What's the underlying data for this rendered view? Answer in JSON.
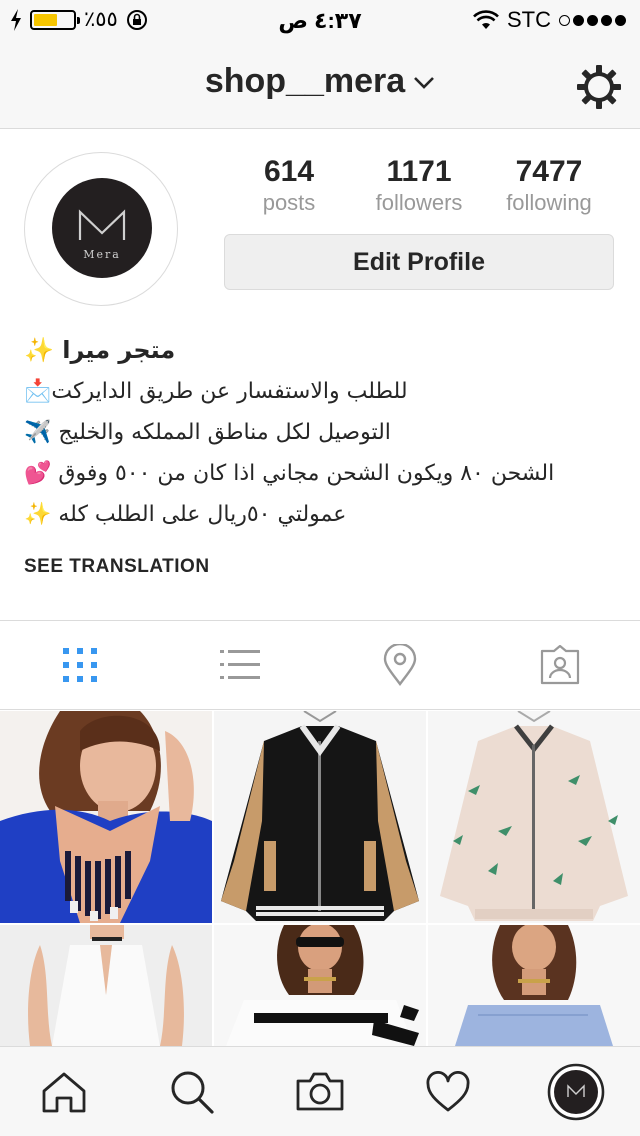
{
  "status_bar": {
    "battery_text": "٪٥٥",
    "battery_level": 0.55,
    "time": "٤:٣٧ ص",
    "carrier": "STC"
  },
  "header": {
    "username": "shop__mera",
    "settings_icon": "gear-icon"
  },
  "profile": {
    "avatar_text": "Mera",
    "stats": [
      {
        "value": "614",
        "label": "posts"
      },
      {
        "value": "1171",
        "label": "followers"
      },
      {
        "value": "7477",
        "label": "following"
      }
    ],
    "edit_profile_label": "Edit Profile",
    "bio": {
      "name": "متجر ميرا ✨",
      "lines": [
        "للطلب والاستفسار عن طريق الدايركت📩",
        "التوصيل لكل مناطق المملكه والخليج ✈️",
        "الشحن ٨٠ ويكون الشحن مجاني اذا كان من ٥٠٠ وفوق 💕",
        "عمولتي ٥٠ريال على الطلب كله ✨"
      ]
    },
    "see_translation": "SEE TRANSLATION"
  },
  "tabs": [
    {
      "icon": "grid-icon",
      "active": true
    },
    {
      "icon": "list-icon",
      "active": false
    },
    {
      "icon": "location-pin-icon",
      "active": false
    },
    {
      "icon": "tagged-photos-icon",
      "active": false
    }
  ],
  "grid": {
    "photos": [
      {
        "subject": "model-blue-top-necklace"
      },
      {
        "subject": "black-gold-bomber-jacket"
      },
      {
        "subject": "pink-floral-bomber-jacket"
      },
      {
        "subject": "white-halter-dress"
      },
      {
        "subject": "black-white-off-shoulder-top"
      },
      {
        "subject": "blue-off-shoulder-top"
      }
    ]
  },
  "bottom_nav": [
    {
      "icon": "home-icon"
    },
    {
      "icon": "search-icon"
    },
    {
      "icon": "camera-icon"
    },
    {
      "icon": "heart-icon"
    },
    {
      "icon": "profile-avatar-icon"
    }
  ],
  "colors": {
    "accent_blue": "#3897f0",
    "text": "#262626",
    "muted": "#999999",
    "border": "#dbdbdb"
  }
}
